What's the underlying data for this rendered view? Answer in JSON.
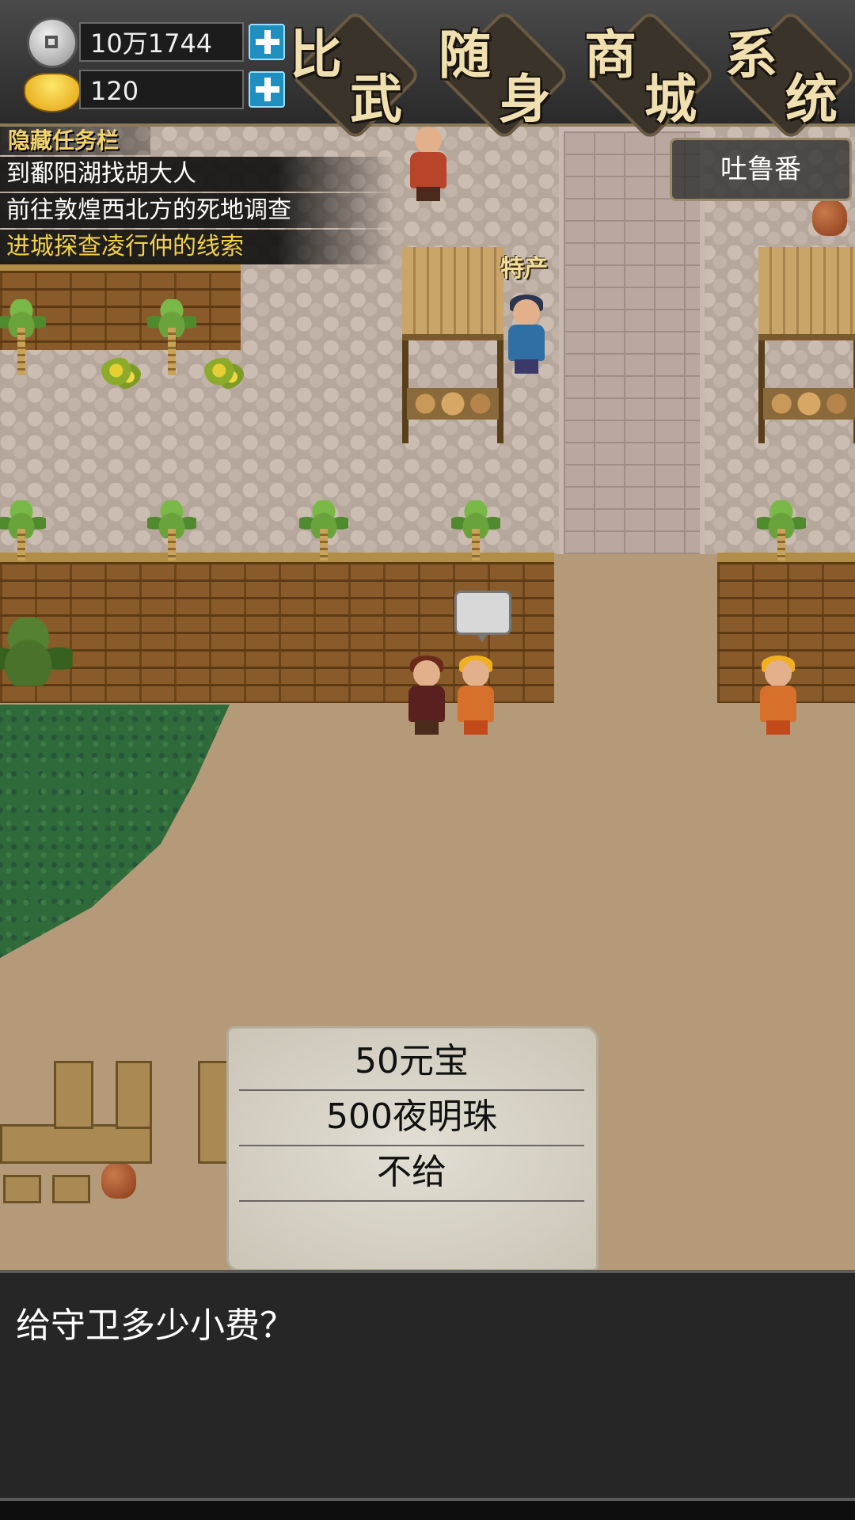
{
  "hud": {
    "silver": {
      "icon": "silver-coin-icon",
      "value": "10万1744"
    },
    "gold": {
      "icon": "gold-ingot-icon",
      "value": "120"
    },
    "menu": [
      {
        "id": "duel",
        "label": "比武",
        "c1": "比",
        "c2": "武"
      },
      {
        "id": "inventory",
        "label": "随身",
        "c1": "随",
        "c2": "身"
      },
      {
        "id": "shop",
        "label": "商城",
        "c1": "商",
        "c2": "城"
      },
      {
        "id": "system",
        "label": "系统",
        "c1": "系",
        "c2": "统"
      }
    ]
  },
  "quests": {
    "header": "隐藏任务栏",
    "items": [
      {
        "text": "到鄱阳湖找胡大人",
        "active": false
      },
      {
        "text": "前往敦煌西北方的死地调查",
        "active": false
      },
      {
        "text": "进城探查凌行仲的线索",
        "active": true
      }
    ]
  },
  "location": "吐鲁番",
  "world": {
    "stall_sign": "特产"
  },
  "choices": [
    "50元宝",
    "500夜明珠",
    "不给"
  ],
  "dialog": {
    "text": "给守卫多少小费？"
  },
  "colors": {
    "active_quest": "#f3d046",
    "plus_button": "#1f8fc0",
    "dialog_bg": "#262626",
    "choice_panel": "#d8d4c8"
  }
}
